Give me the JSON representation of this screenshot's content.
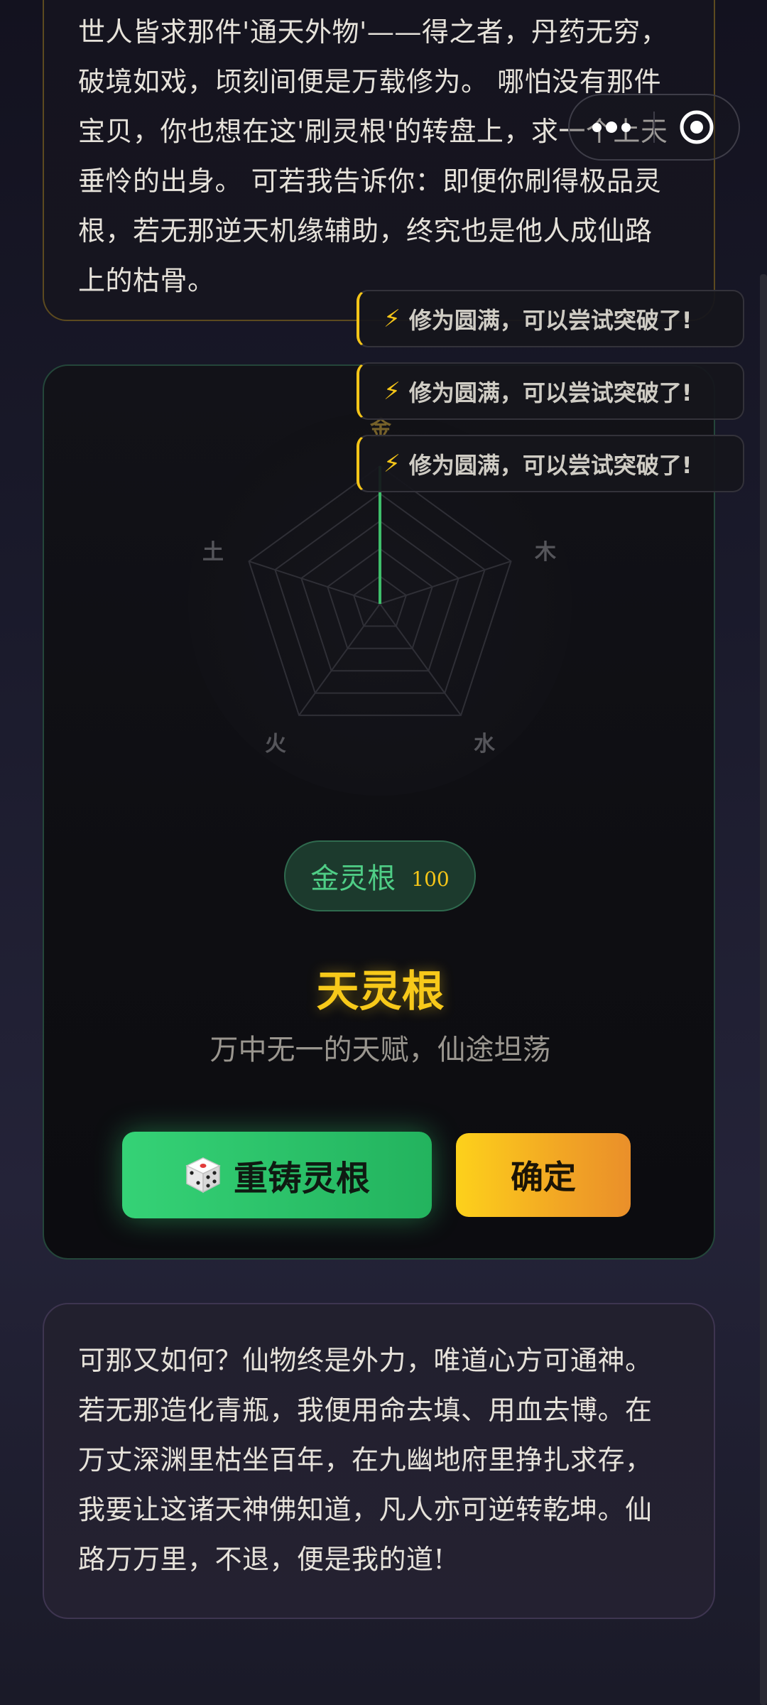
{
  "story_top": {
    "lines": [
      "世人皆求那件'通天外物'——得之者，丹药无穷，",
      "破境如戏，顷刻间便是万载修为。 哪怕没有那件",
      "宝贝，你也想在这'刷灵根'的转盘上，求一个上天",
      "垂怜的出身。 可若我告诉你：即便你刷得极品灵",
      "根，若无那逆天机缘辅助，终究也是他人成仙路",
      "上的枯骨。"
    ]
  },
  "capsule": {
    "more_icon": "more-dots-icon",
    "close_icon": "target-circle-icon"
  },
  "toasts": [
    {
      "icon": "⚡",
      "text": "修为圆满，可以尝试突破了!"
    },
    {
      "icon": "⚡",
      "text": "修为圆满，可以尝试突破了!"
    },
    {
      "icon": "⚡",
      "text": "修为圆满，可以尝试突破了!"
    }
  ],
  "radar": {
    "labels": {
      "metal": "金",
      "wood": "木",
      "water": "水",
      "fire": "火",
      "earth": "土"
    },
    "values": {
      "金": 100,
      "木": 0,
      "水": 0,
      "火": 0,
      "土": 0
    },
    "max": 100,
    "accent_color": "#3fbf6b"
  },
  "root_result": {
    "name": "金灵根",
    "score": "100",
    "tier": "天灵根",
    "description": "万中无一的天赋，仙途坦荡"
  },
  "actions": {
    "reforge_label": "重铸灵根",
    "reforge_icon": "dice-icon",
    "confirm_label": "确定"
  },
  "story_bottom": {
    "lines": [
      "可那又如何？仙物终是外力，唯道心方可通神。",
      "若无那造化青瓶，我便用命去填、用血去博。在",
      "万丈深渊里枯坐百年，在九幽地府里挣扎求存，",
      "我要让这诸天神佛知道，凡人亦可逆转乾坤。仙",
      "路万万里，不退，便是我的道!"
    ]
  },
  "colors": {
    "gold": "#f7c91a",
    "green": "#35d276",
    "toast_accent": "#f5c518"
  }
}
